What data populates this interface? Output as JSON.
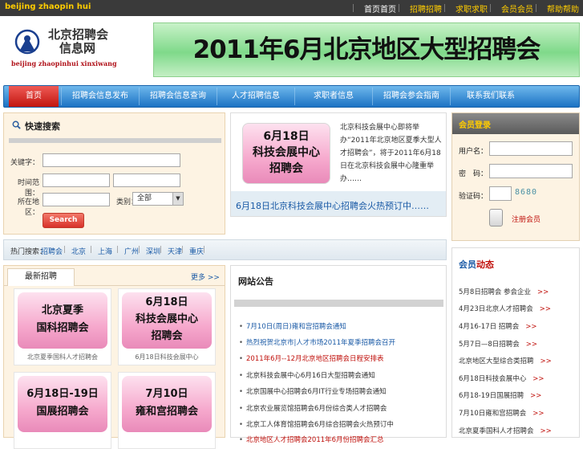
{
  "topbar": {
    "site_name_en": "beijing zhaopin hui",
    "links": [
      "首页首页",
      "招聘招聘",
      "求职求职",
      "会员会员",
      "帮助帮助"
    ]
  },
  "logo": {
    "line1": "北京招聘会",
    "line2": "信息网",
    "english": "beijing zhaopinhui xinxiwang"
  },
  "banner": {
    "text": "2011年6月北京地区大型招聘会"
  },
  "nav": {
    "items": [
      "首页",
      "招聘会信息发布",
      "招聘会信息查询",
      "人才招聘信息",
      "求职者信息",
      "招聘会参会指南",
      "联系我们联系"
    ]
  },
  "search": {
    "title": "快速搜索",
    "fields": [
      {
        "label": "关键字："
      },
      {
        "label": "时间范围："
      },
      {
        "label": "所在地区：",
        "select_label": "类别：",
        "select_value": "全部"
      }
    ],
    "button": "Search"
  },
  "feature": {
    "image_text": [
      "6月18日",
      "科技会展中心",
      "招聘会"
    ],
    "text": "北京科技会展中心即将举办“2011年北京地区夏季大型人才招聘会”，将于2011年6月18日在北京科技会展中心隆重举办……",
    "link": "6月18日北京科技会展中心招聘会火热预订中……"
  },
  "login": {
    "title": "会员登录",
    "username_label": "用户名：",
    "password_label": "密　码：",
    "captcha_label": "验证码：",
    "captcha_value": "8680",
    "register": "注册会员"
  },
  "hotbar": {
    "label": "热门搜索：",
    "links": [
      "招聘会",
      "北京",
      "上海",
      "广州",
      "深圳",
      "天津",
      "重庆"
    ]
  },
  "fairs": {
    "tab": "最新招聘",
    "more": "更多 >>",
    "cards": [
      {
        "image_text": [
          "北京夏季",
          "国科招聘会"
        ],
        "caption": "北京夏季国科人才招聘会"
      },
      {
        "image_text": [
          "6月18日",
          "科技会展中心",
          "招聘会"
        ],
        "caption": "6月18日科技会展中心"
      },
      {
        "image_text": [
          "6月18日-19日",
          "国展招聘会"
        ],
        "caption": ""
      },
      {
        "image_text": [
          "7月10日",
          "雍和宫招聘会"
        ],
        "caption": ""
      }
    ]
  },
  "notice": {
    "title": "网站公告",
    "items": [
      {
        "text": "7月10日(周日)雍和宫招聘会通知",
        "red": false
      },
      {
        "text": "热烈祝贺北京市|人才市场2011年夏季招聘会召开",
        "red": false
      },
      {
        "text": "2011年6月--12月北京地区招聘会日程安排表",
        "red": true
      },
      {
        "text": "北京科技会展中心6月16日大型招聘会通知",
        "red": false
      },
      {
        "text": "北京国展中心招聘会6月IT行业专场招聘会通知",
        "red": false
      },
      {
        "text": "北京农业展览馆招聘会6月份综合类人才招聘会",
        "red": false
      },
      {
        "text": "北京工人体育馆招聘会6月综合招聘会火热预订中",
        "red": false
      },
      {
        "text": "北京地区人才招聘会2011年6月份招聘会汇总",
        "red": true
      }
    ]
  },
  "member": {
    "title_a": "会员",
    "title_b": "动态",
    "arrow": ">>",
    "items": [
      "5月8日招聘会 参会企业",
      "4月23日北京人才招聘会",
      "4月16-17日 招聘会",
      "5月7日—8日招聘会",
      "北京地区大型综合类招聘",
      "6月18日科技会展中心",
      "6月18-19日国展招聘",
      "7月10日雍和宫招聘会",
      "北京夏季国科人才招聘会"
    ]
  },
  "colors": {
    "topbar": "#3a3a3a",
    "topbar_link": "#ffcc00",
    "nav_blue": "#1b72c4",
    "nav_active": "#c1150f",
    "link_blue": "#1a5aa6",
    "accent_red": "#c0110c",
    "panel_bg": "#fdf3e3"
  },
  "icons": [
    "search-icon",
    "logo-emblem-icon",
    "dropdown-arrow-icon"
  ]
}
